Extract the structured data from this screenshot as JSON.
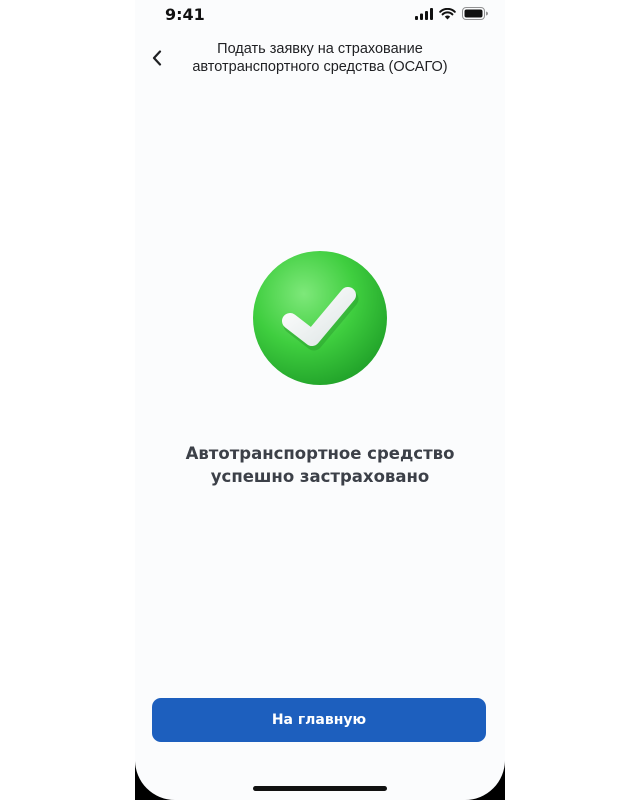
{
  "status_bar": {
    "time": "9:41",
    "icons": [
      "cellular-signal-icon",
      "wifi-icon",
      "battery-icon"
    ]
  },
  "header": {
    "back_icon": "chevron-left-icon",
    "title": "Подать заявку на страхование автотранспортного средства (ОСАГО)"
  },
  "main": {
    "success_icon": "green-checkmark-icon",
    "message": "Автотранспортное средство успешно застраховано"
  },
  "footer": {
    "home_button_label": "На главную"
  },
  "colors": {
    "primary_button": "#1d5fbe",
    "success_green": "#3fce3f",
    "text_dark": "#3c4048"
  }
}
